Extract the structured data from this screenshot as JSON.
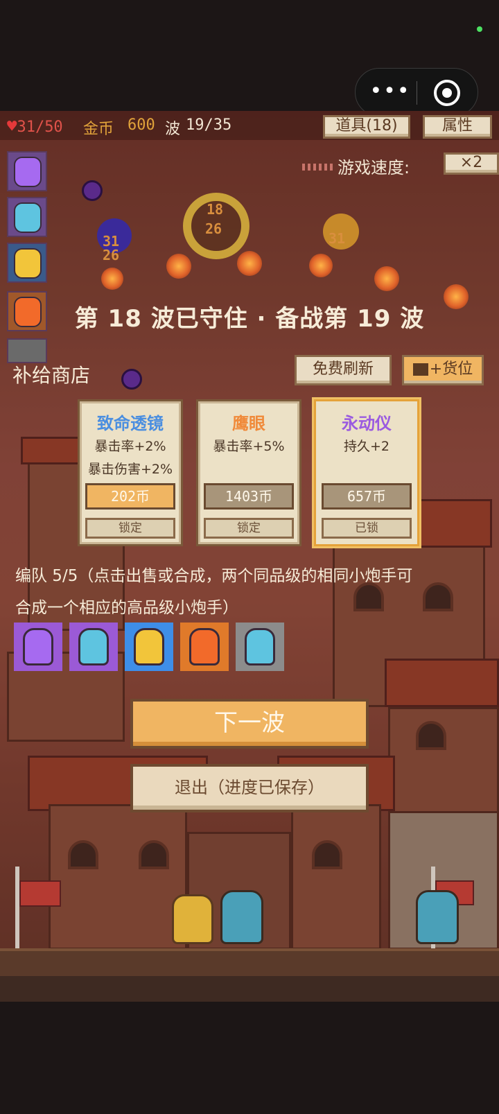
{
  "status": {
    "indicator_color": "#4ce062"
  },
  "capsule": {
    "more_icon": "more-dots-icon",
    "close_icon": "close-circle-icon"
  },
  "hud": {
    "hp_current": "31",
    "hp_max": "50",
    "hp_text": "31/50",
    "gold_label": "金币",
    "gold_value": "600",
    "wave_label": "波",
    "wave_value": "19/35",
    "items_button": "道具(18)",
    "attr_button": "属性",
    "speed_label": "游戏速度:",
    "speed_value": "×2"
  },
  "damage_numbers": [
    "18",
    "26",
    "31",
    "26",
    "31"
  ],
  "banner": "第 18 波已守住 · 备战第 19 波",
  "shop": {
    "title": "补给商店",
    "refresh_button": "免费刷新",
    "add_slot_button": "+货位",
    "cards": [
      {
        "name": "致命透镜",
        "name_color": "#4a8ee0",
        "effects": [
          "暴击率+2%",
          "暴击伤害+2%"
        ],
        "price": "202币",
        "price_bg": "#f0b562",
        "lock_label": "锁定",
        "selected": false
      },
      {
        "name": "鹰眼",
        "name_color": "#f08a3a",
        "effects": [
          "暴击率+5%"
        ],
        "price": "1403币",
        "price_bg": "#a8957a",
        "lock_label": "锁定",
        "selected": false
      },
      {
        "name": "永动仪",
        "name_color": "#9a5ae0",
        "effects": [
          "持久+2"
        ],
        "price": "657币",
        "price_bg": "#a8957a",
        "lock_label": "已锁",
        "selected": true
      }
    ]
  },
  "squad": {
    "line1": "编队 5/5（点击出售或合成，两个同品级的相同小炮手可",
    "line2": "合成一个相应的高品级小炮手）",
    "slots": [
      {
        "tier": "purple",
        "bg": "#9b5ad6",
        "body": "#a66af0"
      },
      {
        "tier": "purple",
        "bg": "#9b5ad6",
        "body": "#5ec4e0"
      },
      {
        "tier": "blue",
        "bg": "#3e8ee8",
        "body": "#f2c53a"
      },
      {
        "tier": "orange",
        "bg": "#e07a2a",
        "body": "#f26a2a"
      },
      {
        "tier": "gray",
        "bg": "#8c8c8c",
        "body": "#5ec4e0"
      }
    ]
  },
  "buttons": {
    "next_wave": "下一波",
    "exit": "退出（进度已保存）"
  }
}
